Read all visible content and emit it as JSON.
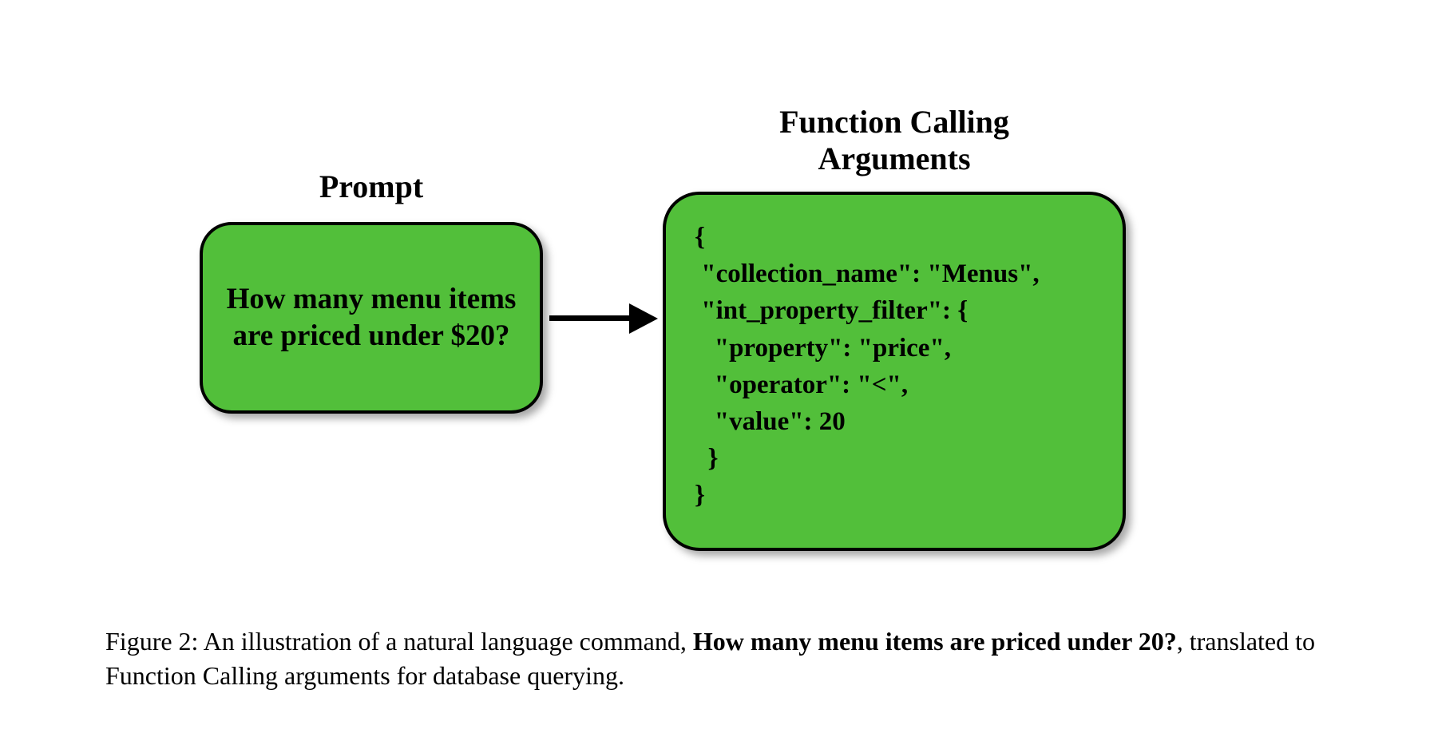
{
  "labels": {
    "prompt": "Prompt",
    "function_calling": "Function Calling\nArguments"
  },
  "prompt_box": {
    "text": "How many menu items\nare priced under $20?"
  },
  "fc_box": {
    "code": "{\n \"collection_name\": \"Menus\",\n \"int_property_filter\": {\n   \"property\": \"price\",\n   \"operator\": \"<\",\n   \"value\": 20\n  }\n}"
  },
  "caption": {
    "prefix": "Figure 2: An illustration of a natural language command, ",
    "bold": "How many menu items are priced under 20?",
    "suffix": ", translated to Function Calling arguments for database querying."
  },
  "colors": {
    "box_fill": "#52bf3a",
    "box_border": "#000000"
  }
}
